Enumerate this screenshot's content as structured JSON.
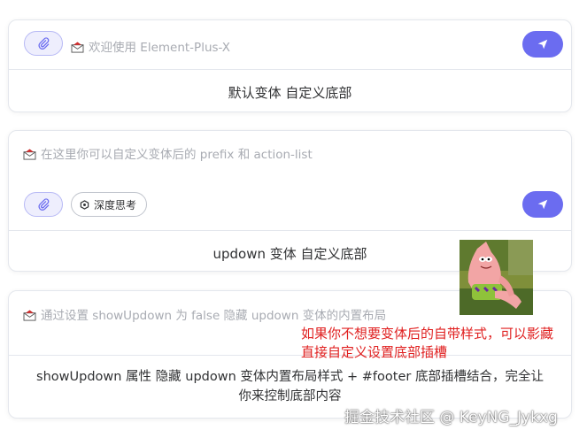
{
  "card1": {
    "placeholder": "欢迎使用 Element-Plus-X",
    "footer": "默认变体 自定义底部"
  },
  "card2": {
    "placeholder": "在这里你可以自定义变体后的 prefix 和 action-list",
    "chip_label": "深度思考",
    "footer": "updown 变体 自定义底部"
  },
  "card3": {
    "placeholder": "通过设置 showUpdown 为 false 隐藏 updown 变体的内置布局",
    "footer_line1": "showUpdown 属性 隐藏 updown 变体内置布局样式 + #footer 底部插槽结合，完全让",
    "footer_line2": "你来控制底部内容"
  },
  "annotation": {
    "line1": "如果你不想要变体后的自带样式，可以影藏",
    "line2": "直接自定义设置底部插槽"
  },
  "watermark": "掘金技术社区 @ KeyNG_Jykxg",
  "icons": {
    "attach": "paperclip-icon",
    "send": "send-icon",
    "prefix": "envelope-icon",
    "chip": "thinking-icon"
  },
  "colors": {
    "accent": "#6b6cf0",
    "attach_bg": "#eeeefd",
    "annotation": "#e02020"
  }
}
